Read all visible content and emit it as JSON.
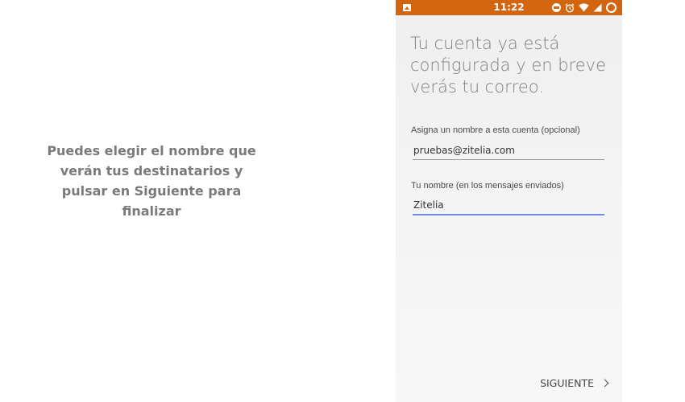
{
  "instruction": {
    "text": "Puedes elegir el nombre que verán tus destinatarios y pulsar en Siguiente para finalizar"
  },
  "status_bar": {
    "time": "11:22",
    "color": "#d4650f",
    "icons": [
      "gallery-icon",
      "do-not-disturb-icon",
      "alarm-icon",
      "wifi-icon",
      "signal-icon",
      "battery-icon"
    ]
  },
  "screen": {
    "headline": "Tu cuenta ya está configurada y en breve verás tu correo.",
    "account_name": {
      "label": "Asigna un nombre a esta cuenta (opcional)",
      "value": "pruebas@zitelia.com"
    },
    "your_name": {
      "label": "Tu nombre (en los mensajes enviados)",
      "value": "Zitelia"
    },
    "next_label": "SIGUIENTE"
  }
}
